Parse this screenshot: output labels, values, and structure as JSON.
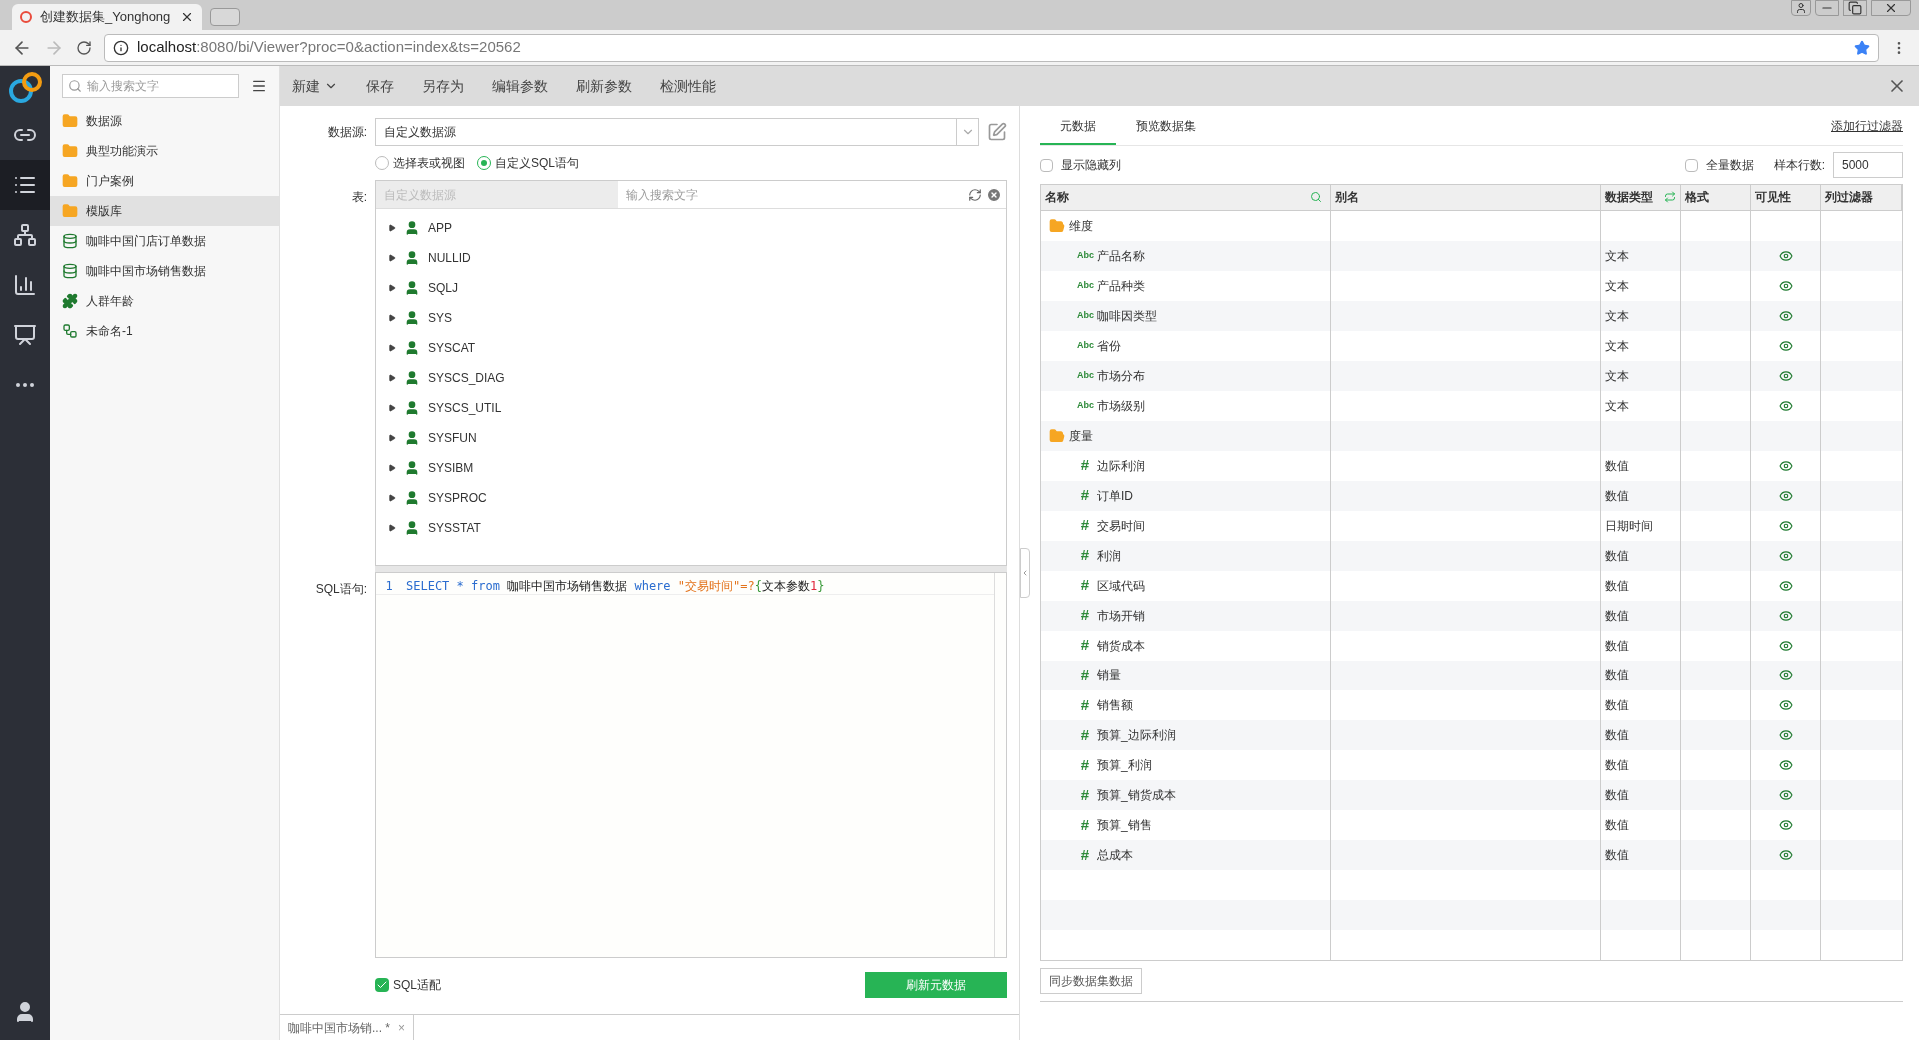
{
  "browser": {
    "tab_title": "创建数据集_Yonghong",
    "url_host": "localhost",
    "url_rest": ":8080/bi/Viewer?proc=0&action=index&ts=20562"
  },
  "rail": [
    {
      "kind": "link",
      "selected": false
    },
    {
      "kind": "list",
      "selected": true
    },
    {
      "kind": "network",
      "selected": false
    },
    {
      "kind": "chart",
      "selected": false
    },
    {
      "kind": "screen",
      "selected": false
    },
    {
      "kind": "more",
      "selected": false
    }
  ],
  "sidebar": {
    "search_placeholder": "输入搜索文字",
    "items": [
      {
        "kind": "folder",
        "label": "数据源",
        "selected": false
      },
      {
        "kind": "folder",
        "label": "典型功能演示",
        "selected": false
      },
      {
        "kind": "folder",
        "label": "门户案例",
        "selected": false
      },
      {
        "kind": "folder",
        "label": "模版库",
        "selected": true
      },
      {
        "kind": "dataset",
        "label": "咖啡中国门店订单数据",
        "selected": false
      },
      {
        "kind": "dataset",
        "label": "咖啡中国市场销售数据",
        "selected": false
      },
      {
        "kind": "combo",
        "label": "人群年龄",
        "selected": false
      },
      {
        "kind": "flow",
        "label": "未命名-1",
        "selected": false
      }
    ]
  },
  "toolbar": [
    {
      "label": "新建",
      "dropdown": true
    },
    {
      "label": "保存",
      "dropdown": false
    },
    {
      "label": "另存为",
      "dropdown": false
    },
    {
      "label": "编辑参数",
      "dropdown": false
    },
    {
      "label": "刷新参数",
      "dropdown": false
    },
    {
      "label": "检测性能",
      "dropdown": false
    }
  ],
  "form": {
    "datasource_label": "数据源:",
    "datasource_value": "自定义数据源",
    "radios": [
      {
        "label": "选择表或视图",
        "selected": false
      },
      {
        "label": "自定义SQL语句",
        "selected": true
      }
    ],
    "table_label": "表:",
    "table_source_placeholder": "自定义数据源",
    "table_search_placeholder": "输入搜索文字",
    "schemas": [
      "APP",
      "NULLID",
      "SQLJ",
      "SYS",
      "SYSCAT",
      "SYSCS_DIAG",
      "SYSCS_UTIL",
      "SYSFUN",
      "SYSIBM",
      "SYSPROC",
      "SYSSTAT"
    ],
    "sql_label": "SQL语句:",
    "line_number": "1",
    "sql": [
      {
        "kind": "keyword",
        "text": "SELECT"
      },
      {
        "kind": "operator",
        "text": "*"
      },
      {
        "kind": "keyword",
        "text": "from"
      },
      {
        "kind": "plain",
        "text": "咖啡中国市场销售数据"
      },
      {
        "kind": "keyword",
        "text": "where"
      },
      {
        "kind": "string",
        "text": "\"交易时间\"=?"
      },
      {
        "kind": "bracket",
        "text": "{"
      },
      {
        "kind": "plain",
        "text": "文本参数"
      },
      {
        "kind": "number",
        "text": "1"
      },
      {
        "kind": "bracket",
        "text": "}"
      }
    ],
    "sql_adapt": {
      "label": "SQL适配",
      "checked": true
    },
    "refresh_button": "刷新元数据"
  },
  "meta": {
    "tabs": [
      {
        "label": "元数据",
        "selected": true
      },
      {
        "label": "预览数据集",
        "selected": false
      }
    ],
    "add_filter": "添加行过滤器",
    "show_hidden": {
      "label": "显示隐藏列",
      "checked": false
    },
    "full_data": {
      "label": "全量数据",
      "checked": false
    },
    "sample_label": "样本行数:",
    "sample_value": "5000",
    "columns": [
      "名称",
      "别名",
      "数据类型",
      "格式",
      "可见性",
      "列过滤器"
    ],
    "rows": [
      {
        "kind": "group",
        "name": "维度"
      },
      {
        "kind": "text",
        "icon": "Abc",
        "name": "产品名称",
        "type": "文本",
        "visible": true
      },
      {
        "kind": "text",
        "icon": "Abc",
        "name": "产品种类",
        "type": "文本",
        "visible": true
      },
      {
        "kind": "text",
        "icon": "Abc",
        "name": "咖啡因类型",
        "type": "文本",
        "visible": true
      },
      {
        "kind": "text",
        "icon": "Abc",
        "name": "省份",
        "type": "文本",
        "visible": true
      },
      {
        "kind": "text",
        "icon": "Abc",
        "name": "市场分布",
        "type": "文本",
        "visible": true
      },
      {
        "kind": "text",
        "icon": "Abc",
        "name": "市场级别",
        "type": "文本",
        "visible": true
      },
      {
        "kind": "group",
        "name": "度量"
      },
      {
        "kind": "number",
        "icon": "#",
        "name": "边际利润",
        "type": "数值",
        "visible": true
      },
      {
        "kind": "number",
        "icon": "#",
        "name": "订单ID",
        "type": "数值",
        "visible": true
      },
      {
        "kind": "number",
        "icon": "#",
        "name": "交易时间",
        "type": "日期时间",
        "visible": true
      },
      {
        "kind": "number",
        "icon": "#",
        "name": "利润",
        "type": "数值",
        "visible": true
      },
      {
        "kind": "number",
        "icon": "#",
        "name": "区域代码",
        "type": "数值",
        "visible": true
      },
      {
        "kind": "number",
        "icon": "#",
        "name": "市场开销",
        "type": "数值",
        "visible": true
      },
      {
        "kind": "number",
        "icon": "#",
        "name": "销货成本",
        "type": "数值",
        "visible": true
      },
      {
        "kind": "number",
        "icon": "#",
        "name": "销量",
        "type": "数值",
        "visible": true
      },
      {
        "kind": "number",
        "icon": "#",
        "name": "销售额",
        "type": "数值",
        "visible": true
      },
      {
        "kind": "number",
        "icon": "#",
        "name": "预算_边际利润",
        "type": "数值",
        "visible": true
      },
      {
        "kind": "number",
        "icon": "#",
        "name": "预算_利润",
        "type": "数值",
        "visible": true
      },
      {
        "kind": "number",
        "icon": "#",
        "name": "预算_销货成本",
        "type": "数值",
        "visible": true
      },
      {
        "kind": "number",
        "icon": "#",
        "name": "预算_销售",
        "type": "数值",
        "visible": true
      },
      {
        "kind": "number",
        "icon": "#",
        "name": "总成本",
        "type": "数值",
        "visible": true
      }
    ],
    "sync_button": "同步数据集数据"
  },
  "bottom_tab": {
    "label": "咖啡中国市场销... *",
    "close": "×"
  }
}
